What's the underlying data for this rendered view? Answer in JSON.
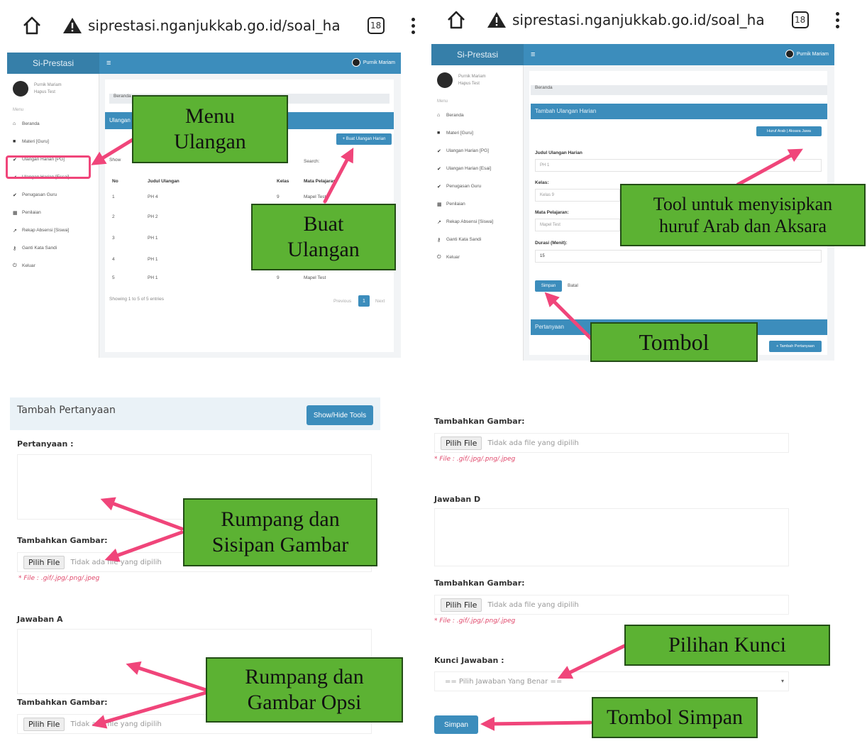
{
  "browser": {
    "url_left": "siprestasi.nganjukkab.go.id/soal_ha",
    "url_right": "siprestasi.nganjukkab.go.id/soal_ha",
    "tabs_count": "18"
  },
  "app": {
    "brand": "Si-Prestasi",
    "menu_icon": "≡",
    "user_name": "Purnik Mariam",
    "user_role": "Hapus Test",
    "menu_section": "Menu",
    "breadcrumb": "Beranda"
  },
  "panel1": {
    "menu": [
      "Beranda",
      "Materi [Guru]",
      "Ulangan Harian [PG]",
      "Ulangan Harian [Essai]",
      "Penugasan Guru",
      "Penilaian",
      "Rekap Absensi [Siswa]",
      "Ganti Kata Sandi",
      "Keluar"
    ],
    "header": "Ulangan",
    "create_btn": "+ Buat Ulangan Harian",
    "show_label": "Show",
    "search_label": "Search:",
    "columns": [
      "No",
      "Judul Ulangan",
      "Kelas",
      "Mata Pelajaran"
    ],
    "rows": [
      [
        "1",
        "PH 4",
        "9",
        "Mapel Test"
      ],
      [
        "2",
        "PH 2",
        "",
        ""
      ],
      [
        "3",
        "PH 1",
        "",
        ""
      ],
      [
        "4",
        "PH 1",
        "",
        ""
      ],
      [
        "5",
        "PH 1",
        "9",
        "Mapel Test"
      ]
    ],
    "footer": "Showing 1 to 5 of 5 entries",
    "prev": "Previous",
    "page": "1",
    "next": "Next"
  },
  "panel2": {
    "menu": [
      "Beranda",
      "Materi [Guru]",
      "Ulangan Harian [PG]",
      "Ulangan Harian [Esai]",
      "Penugasan Guru",
      "Penilaian",
      "Rekap Absensi [Siswa]",
      "Ganti Kata Sandi",
      "Keluar"
    ],
    "header": "Tambah Ulangan Harian",
    "tools": "Huruf Arab | Aksara Jawa",
    "judul_label": "Judul Ulangan Harian",
    "judul_value": "PH 1",
    "kelas_label": "Kelas:",
    "kelas_value": "Kelas 9",
    "mapel_label": "Mata Pelajaran:",
    "mapel_value": "Mapel Test",
    "durasi_label": "Durasi (Menit):",
    "durasi_value": "15",
    "save": "Simpan",
    "cancel": "Batal",
    "pertanyaan": "Pertanyaan",
    "add_q": "+ Tambah Pertanyaan"
  },
  "form_left": {
    "title": "Tambah Pertanyaan",
    "tools_btn": "Show/Hide Tools",
    "pertanyaan_label": "Pertanyaan :",
    "gambar_label": "Tambahkan Gambar:",
    "file_btn": "Pilih File",
    "no_file": "Tidak ada file yang dipilih",
    "file_hint": "* File : .gif/.jpg/.png/.jpeg",
    "jawaban_a": "Jawaban A"
  },
  "form_right": {
    "gambar_label": "Tambahkan Gambar:",
    "file_btn": "Pilih File",
    "no_file": "Tidak ada file yang dipilih",
    "file_hint": "* File : .gif/.jpg/.png/.jpeg",
    "jawaban_d": "Jawaban D",
    "kunci_label": "Kunci Jawaban :",
    "kunci_placeholder": "== Pilih Jawaban Yang Benar ==",
    "save": "Simpan"
  },
  "callouts": {
    "menu_ulangan": [
      "Menu",
      "Ulangan"
    ],
    "buat_ulangan": [
      "Buat",
      "Ulangan"
    ],
    "tool": [
      "Tool untuk menyisipkan",
      "huruf Arab dan Aksara"
    ],
    "tombol": "Tombol",
    "rumpang_gambar": [
      "Rumpang dan",
      "Sisipan Gambar"
    ],
    "rumpang_opsi": [
      "Rumpang dan",
      "Gambar Opsi"
    ],
    "pilihan_kunci": "Pilihan Kunci",
    "tombol_simpan": "Tombol Simpan"
  },
  "colors": {
    "callout_green": "#5cb233",
    "arrow_pink": "#f0457a",
    "app_blue": "#3c8dbc"
  }
}
